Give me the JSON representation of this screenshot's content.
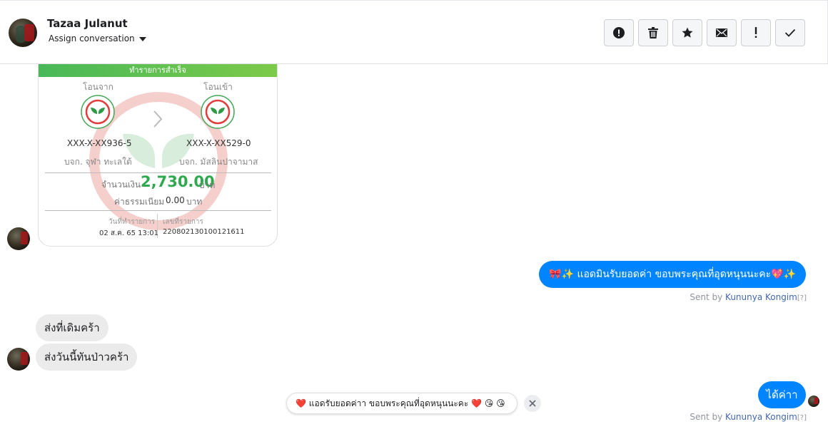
{
  "header": {
    "contact_name": "Tazaa Julanut",
    "assign_label": "Assign conversation",
    "actions": [
      {
        "name": "spam-button",
        "icon": "alert-circle-icon"
      },
      {
        "name": "delete-button",
        "icon": "trash-icon"
      },
      {
        "name": "star-button",
        "icon": "star-icon"
      },
      {
        "name": "mark-unread-button",
        "icon": "envelope-icon"
      },
      {
        "name": "important-button",
        "icon": "exclamation-icon"
      },
      {
        "name": "done-button",
        "icon": "checkmark-icon"
      }
    ]
  },
  "receipt": {
    "status": "ทำรายการสำเร็จ",
    "from_label": "โอนจาก",
    "to_label": "โอนเข้า",
    "from_account": "XXX-X-XX936-5",
    "to_account": "XXX-X-XX529-0",
    "from_name": "บจก. จุฬา ทะเลใต้",
    "to_name": "บจก. มัสลินปาจามาส",
    "amount_label": "จำนวนเงิน",
    "amount": "2,730.00",
    "amount_unit": "บาท",
    "fee_label": "ค่าธรรมเนียม",
    "fee": "0.00",
    "fee_unit": "บาท",
    "date_label": "วันที่ทำรายการ",
    "date_value": "02 ส.ค. 65 13:01",
    "ref_label": "เลขที่รายการ",
    "ref_value": "220802130100121611"
  },
  "messages": {
    "outgoing_1": "🎀✨ แอดมินรับยอดค่า ขอบพระคุณที่อุดหนุนนะคะ💖✨",
    "sent_by_prefix": "Sent by",
    "agent_name": "Kununya Kongim",
    "help_mark": "[?]",
    "incoming_1": "ส่งที่เดิมคร้า",
    "incoming_2": "ส่งวันนี้ทันป่าวคร้า",
    "outgoing_2": "ได้ค่าา"
  },
  "toast": {
    "text": "แอดรับยอดค่าา ขอบพระคุณที่อุดหนุนนะคะ",
    "lead_emoji": "❤️",
    "trail_emoji": "❤️ 😘 😘"
  },
  "colors": {
    "accent": "#0084ff",
    "receipt_green": "#2fa84f",
    "link": "#4267b2"
  }
}
